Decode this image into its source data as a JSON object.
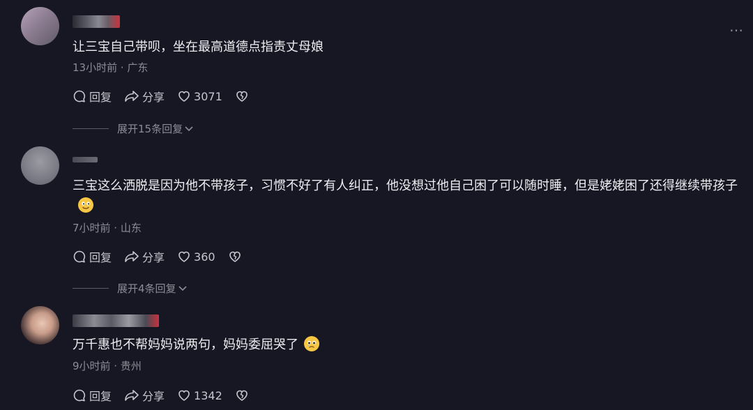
{
  "comments": [
    {
      "text": "让三宝自己带呗，坐在最高道德点指责丈母娘",
      "meta": "13小时前 · 广东",
      "reply": "回复",
      "share": "分享",
      "likes": "3071",
      "expand": "展开15条回复"
    },
    {
      "text": "三宝这么洒脱是因为他不带孩子，习惯不好了有人纠正，他没想过他自己困了可以随时睡，但是姥姥困了还得继续带孩子",
      "meta": "7小时前 · 山东",
      "reply": "回复",
      "share": "分享",
      "likes": "360",
      "expand": "展开4条回复"
    },
    {
      "text": "万千惠也不帮妈妈说两句，妈妈委屈哭了",
      "meta": "9小时前 · 贵州",
      "reply": "回复",
      "share": "分享",
      "likes": "1342"
    }
  ],
  "more_icon": "…"
}
